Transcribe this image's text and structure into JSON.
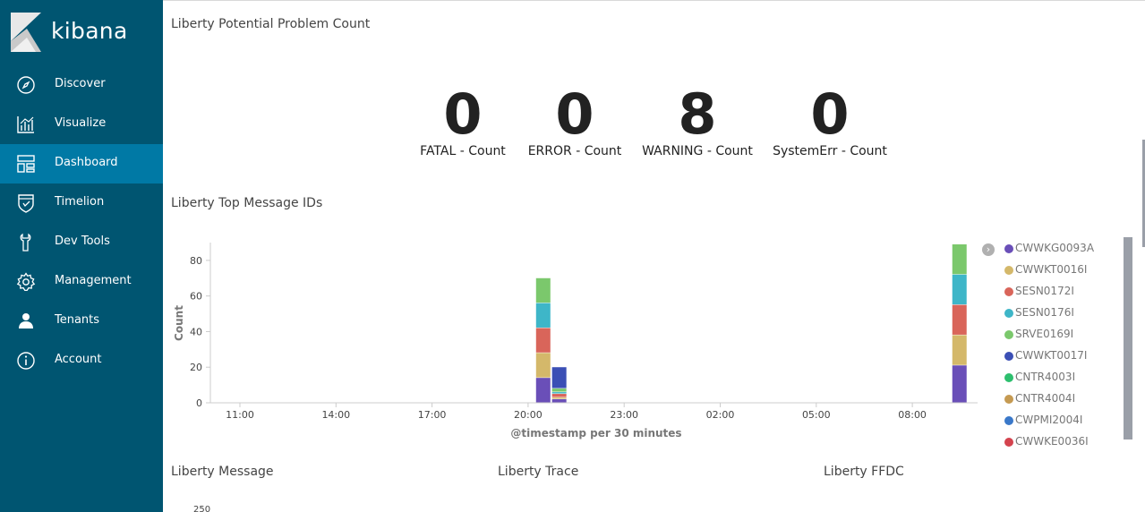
{
  "app": {
    "name": "kibana"
  },
  "sidebar": {
    "items": [
      {
        "label": "Discover",
        "icon": "compass-icon"
      },
      {
        "label": "Visualize",
        "icon": "bar-chart-icon"
      },
      {
        "label": "Dashboard",
        "icon": "dashboard-icon",
        "active": true
      },
      {
        "label": "Timelion",
        "icon": "shield-icon"
      },
      {
        "label": "Dev Tools",
        "icon": "wrench-icon"
      },
      {
        "label": "Management",
        "icon": "gear-icon"
      },
      {
        "label": "Tenants",
        "icon": "user-icon"
      },
      {
        "label": "Account",
        "icon": "info-icon"
      }
    ]
  },
  "panels": {
    "problem_count": {
      "title": "Liberty Potential Problem Count",
      "metrics": [
        {
          "value": "0",
          "label": "FATAL - Count"
        },
        {
          "value": "0",
          "label": "ERROR - Count"
        },
        {
          "value": "8",
          "label": "WARNING - Count"
        },
        {
          "value": "0",
          "label": "SystemErr - Count"
        }
      ]
    },
    "top_message_ids": {
      "title": "Liberty Top Message IDs"
    },
    "message": {
      "title": "Liberty Message",
      "partial_tick": "250"
    },
    "trace": {
      "title": "Liberty Trace"
    },
    "ffdc": {
      "title": "Liberty FFDC"
    }
  },
  "chart_data": {
    "type": "bar",
    "stacked": true,
    "xlabel": "@timestamp per 30 minutes",
    "ylabel": "Count",
    "ylim": [
      0,
      90
    ],
    "yticks": [
      0,
      20,
      40,
      60,
      80
    ],
    "xticks": [
      "11:00",
      "14:00",
      "17:00",
      "20:00",
      "23:00",
      "02:00",
      "05:00",
      "08:00"
    ],
    "categories": [
      "20:30",
      "21:00",
      "09:30"
    ],
    "series": [
      {
        "name": "CWWKG0093A",
        "color": "#6a4fb8",
        "values": [
          14,
          2,
          21
        ]
      },
      {
        "name": "CWWKT0016I",
        "color": "#d4b86a",
        "values": [
          14,
          1,
          17
        ]
      },
      {
        "name": "SESN0172I",
        "color": "#d9655a",
        "values": [
          14,
          2,
          17
        ]
      },
      {
        "name": "SESN0176I",
        "color": "#3eb6c8",
        "values": [
          14,
          1,
          17
        ]
      },
      {
        "name": "SRVE0169I",
        "color": "#7bc86c",
        "values": [
          14,
          2,
          17
        ]
      },
      {
        "name": "CWWKT0017I",
        "color": "#3b4fb5",
        "values": [
          0,
          12,
          0
        ]
      },
      {
        "name": "CNTR4003I",
        "color": "#2dbf6e",
        "values": [
          0,
          0,
          0
        ]
      },
      {
        "name": "CNTR4004I",
        "color": "#c59a52",
        "values": [
          0,
          0,
          0
        ]
      },
      {
        "name": "CWPMI2004I",
        "color": "#3a78c9",
        "values": [
          0,
          0,
          0
        ]
      },
      {
        "name": "CWWKE0036I",
        "color": "#d4434e",
        "values": [
          0,
          0,
          0
        ]
      }
    ],
    "legend_position": "right"
  }
}
